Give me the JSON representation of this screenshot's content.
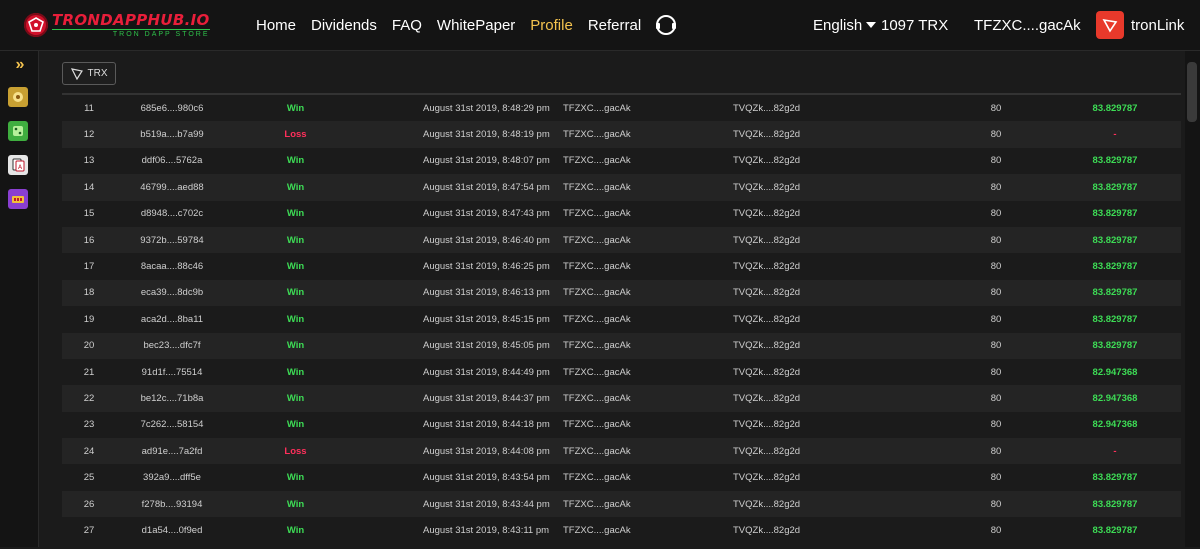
{
  "header": {
    "logo_title": "TRONDAPPHUB.IO",
    "logo_subtitle": "TRON DAPP STORE",
    "nav": [
      "Home",
      "Dividends",
      "FAQ",
      "WhitePaper",
      "Profile",
      "Referral"
    ],
    "active_nav": "Profile",
    "language": "English",
    "balance": "1097 TRX",
    "address": "TFZXC....gacAk",
    "wallet": "tronLink",
    "accent_color": "#f4c34f",
    "brand_color": "#e81e3a"
  },
  "filter": {
    "label": "TRX"
  },
  "sidebar": {
    "icons": [
      "expand-icon",
      "game-icon-1",
      "game-icon-2",
      "cards-icon",
      "slots-icon"
    ]
  },
  "table": {
    "rows": [
      {
        "n": "11",
        "id": "685e6....980c6",
        "result": "Win",
        "time": "August 31st 2019, 8:48:29 pm",
        "from": "TFZXC....gacAk",
        "to": "TVQZk....82g2d",
        "amount": "80",
        "payout": "83.829787"
      },
      {
        "n": "12",
        "id": "b519a....b7a99",
        "result": "Loss",
        "time": "August 31st 2019, 8:48:19 pm",
        "from": "TFZXC....gacAk",
        "to": "TVQZk....82g2d",
        "amount": "80",
        "payout": "-"
      },
      {
        "n": "13",
        "id": "ddf06....5762a",
        "result": "Win",
        "time": "August 31st 2019, 8:48:07 pm",
        "from": "TFZXC....gacAk",
        "to": "TVQZk....82g2d",
        "amount": "80",
        "payout": "83.829787"
      },
      {
        "n": "14",
        "id": "46799....aed88",
        "result": "Win",
        "time": "August 31st 2019, 8:47:54 pm",
        "from": "TFZXC....gacAk",
        "to": "TVQZk....82g2d",
        "amount": "80",
        "payout": "83.829787"
      },
      {
        "n": "15",
        "id": "d8948....c702c",
        "result": "Win",
        "time": "August 31st 2019, 8:47:43 pm",
        "from": "TFZXC....gacAk",
        "to": "TVQZk....82g2d",
        "amount": "80",
        "payout": "83.829787"
      },
      {
        "n": "16",
        "id": "9372b....59784",
        "result": "Win",
        "time": "August 31st 2019, 8:46:40 pm",
        "from": "TFZXC....gacAk",
        "to": "TVQZk....82g2d",
        "amount": "80",
        "payout": "83.829787"
      },
      {
        "n": "17",
        "id": "8acaa....88c46",
        "result": "Win",
        "time": "August 31st 2019, 8:46:25 pm",
        "from": "TFZXC....gacAk",
        "to": "TVQZk....82g2d",
        "amount": "80",
        "payout": "83.829787"
      },
      {
        "n": "18",
        "id": "eca39....8dc9b",
        "result": "Win",
        "time": "August 31st 2019, 8:46:13 pm",
        "from": "TFZXC....gacAk",
        "to": "TVQZk....82g2d",
        "amount": "80",
        "payout": "83.829787"
      },
      {
        "n": "19",
        "id": "aca2d....8ba11",
        "result": "Win",
        "time": "August 31st 2019, 8:45:15 pm",
        "from": "TFZXC....gacAk",
        "to": "TVQZk....82g2d",
        "amount": "80",
        "payout": "83.829787"
      },
      {
        "n": "20",
        "id": "bec23....dfc7f",
        "result": "Win",
        "time": "August 31st 2019, 8:45:05 pm",
        "from": "TFZXC....gacAk",
        "to": "TVQZk....82g2d",
        "amount": "80",
        "payout": "83.829787"
      },
      {
        "n": "21",
        "id": "91d1f....75514",
        "result": "Win",
        "time": "August 31st 2019, 8:44:49 pm",
        "from": "TFZXC....gacAk",
        "to": "TVQZk....82g2d",
        "amount": "80",
        "payout": "82.947368"
      },
      {
        "n": "22",
        "id": "be12c....71b8a",
        "result": "Win",
        "time": "August 31st 2019, 8:44:37 pm",
        "from": "TFZXC....gacAk",
        "to": "TVQZk....82g2d",
        "amount": "80",
        "payout": "82.947368"
      },
      {
        "n": "23",
        "id": "7c262....58154",
        "result": "Win",
        "time": "August 31st 2019, 8:44:18 pm",
        "from": "TFZXC....gacAk",
        "to": "TVQZk....82g2d",
        "amount": "80",
        "payout": "82.947368"
      },
      {
        "n": "24",
        "id": "ad91e....7a2fd",
        "result": "Loss",
        "time": "August 31st 2019, 8:44:08 pm",
        "from": "TFZXC....gacAk",
        "to": "TVQZk....82g2d",
        "amount": "80",
        "payout": "-"
      },
      {
        "n": "25",
        "id": "392a9....dff5e",
        "result": "Win",
        "time": "August 31st 2019, 8:43:54 pm",
        "from": "TFZXC....gacAk",
        "to": "TVQZk....82g2d",
        "amount": "80",
        "payout": "83.829787"
      },
      {
        "n": "26",
        "id": "f278b....93194",
        "result": "Win",
        "time": "August 31st 2019, 8:43:44 pm",
        "from": "TFZXC....gacAk",
        "to": "TVQZk....82g2d",
        "amount": "80",
        "payout": "83.829787"
      },
      {
        "n": "27",
        "id": "d1a54....0f9ed",
        "result": "Win",
        "time": "August 31st 2019, 8:43:11 pm",
        "from": "TFZXC....gacAk",
        "to": "TVQZk....82g2d",
        "amount": "80",
        "payout": "83.829787"
      }
    ]
  }
}
